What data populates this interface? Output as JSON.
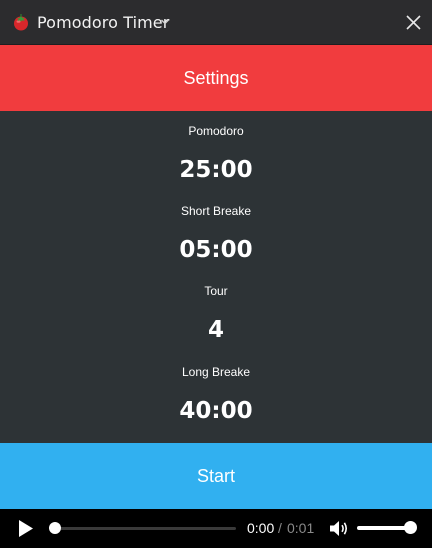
{
  "window": {
    "title": "Pomodoro Timer",
    "icon": "tomato-icon"
  },
  "settings_button": {
    "label": "Settings",
    "color": "#f13c3e"
  },
  "timer_settings": {
    "pomodoro": {
      "label": "Pomodoro",
      "value": "25:00"
    },
    "short_break": {
      "label": "Short Breake",
      "value": "05:00"
    },
    "tour": {
      "label": "Tour",
      "value": "4"
    },
    "long_break": {
      "label": "Long Breake",
      "value": "40:00"
    }
  },
  "start_button": {
    "label": "Start",
    "color": "#31b0f0"
  },
  "audio_player": {
    "current_time": "0:00",
    "separator": "/",
    "duration": "0:01",
    "progress": 0,
    "volume": 1.0
  }
}
